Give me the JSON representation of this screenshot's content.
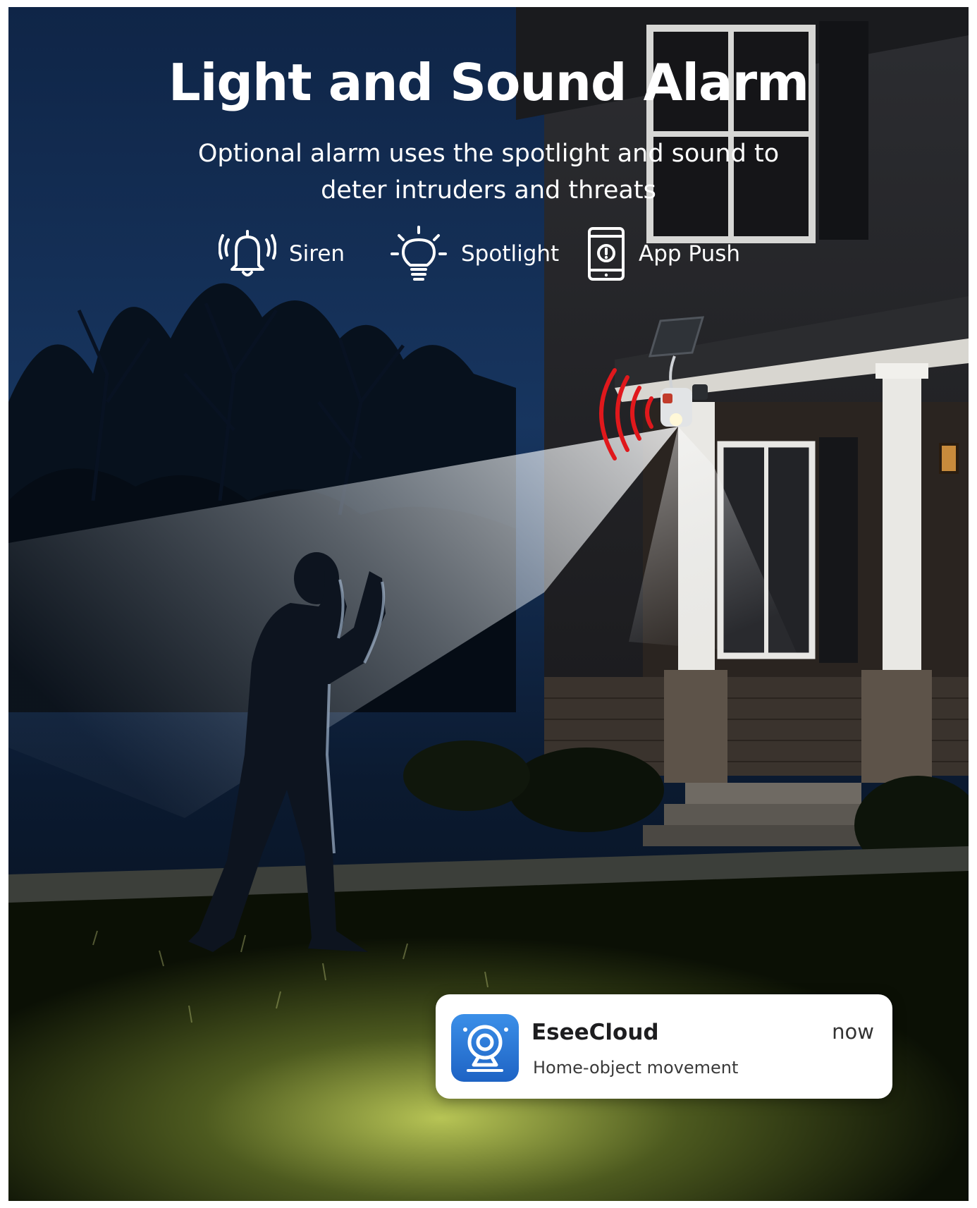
{
  "headline": "Light and Sound Alarm",
  "subheadline": {
    "line1": "Optional alarm uses the spotlight and sound to",
    "line2": "deter intruders and threats"
  },
  "features": [
    {
      "icon": "bell-ringing-icon",
      "label": "Siren"
    },
    {
      "icon": "lightbulb-icon",
      "label": "Spotlight"
    },
    {
      "icon": "smartphone-alert-icon",
      "label": "App Push"
    }
  ],
  "notification": {
    "app_icon": "camera-app-icon",
    "app_name": "EseeCloud",
    "time": "now",
    "message": "Home-object movement"
  },
  "colors": {
    "title_text": "#ffffff",
    "night_sky": "#0f2547",
    "siren_waves": "#e0181c",
    "app_icon_blue": "#2b79d9",
    "notification_bg": "#ffffff"
  }
}
